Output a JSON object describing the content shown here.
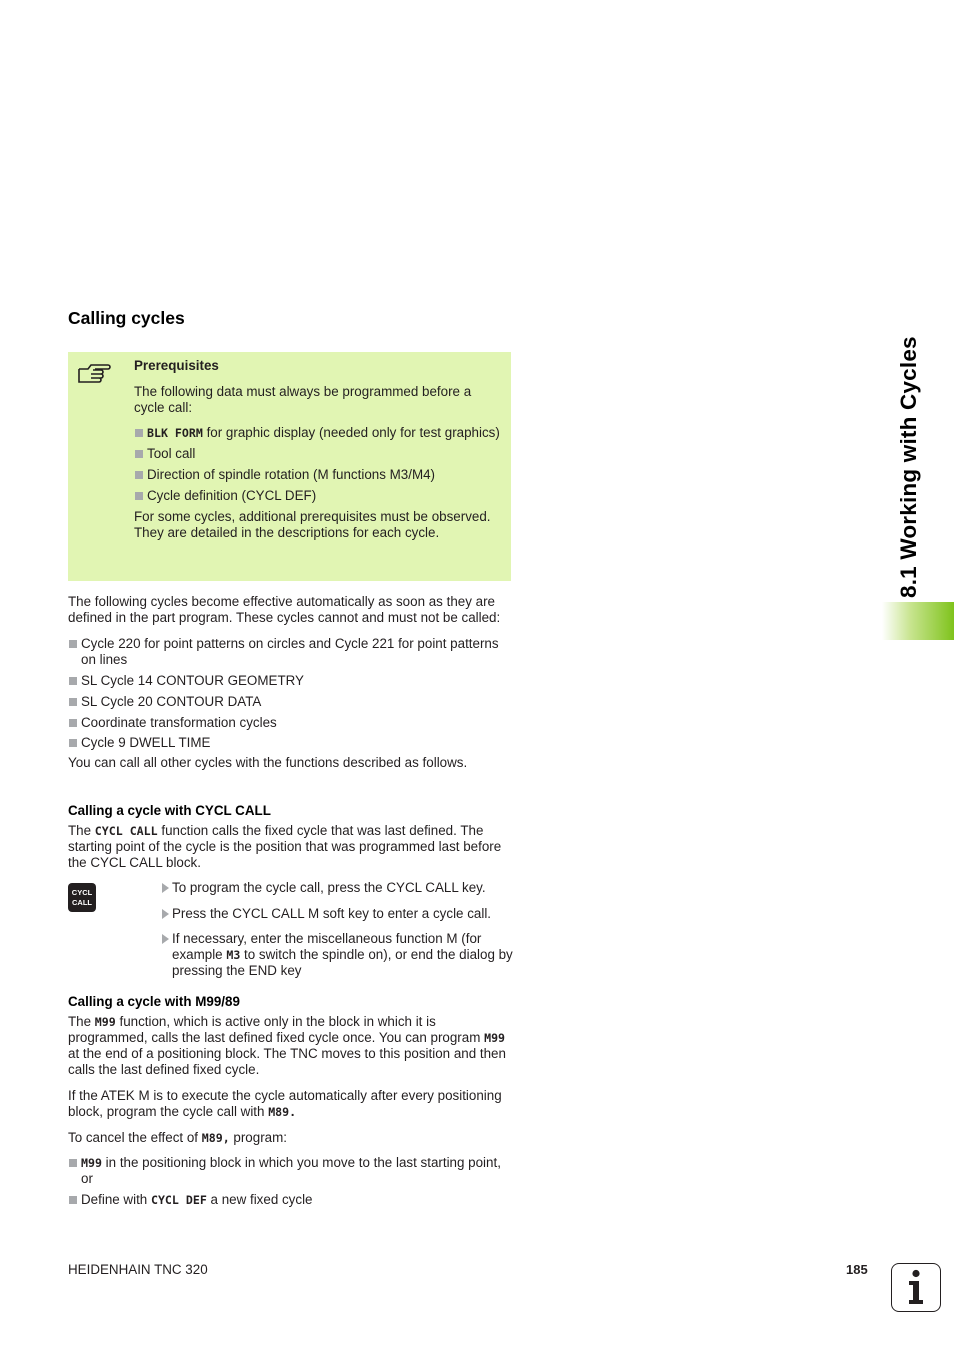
{
  "section_title": "Calling cycles",
  "note": {
    "icon": "pointing-hand-icon",
    "title": "Prerequisites",
    "intro": "The following data must always be programmed before a cycle call:",
    "items": [
      {
        "code": "BLK FORM",
        "text": " for graphic display (needed only for test graphics)"
      },
      {
        "code": "",
        "text": "Tool call"
      },
      {
        "code": "",
        "text": "Direction of spindle rotation (M functions M3/M4)"
      },
      {
        "code": "",
        "text": "Cycle definition (CYCL DEF)"
      }
    ],
    "outro": "For some cycles, additional prerequisites must be observed. They are detailed in the descriptions for each cycle."
  },
  "auto_intro": "The following cycles become effective automatically as soon as they are defined in the part program. These cycles cannot and must not be called:",
  "auto_items": [
    "Cycle 220 for point patterns on circles and Cycle 221 for point patterns on lines",
    "SL Cycle 14 CONTOUR GEOMETRY",
    "SL Cycle 20 CONTOUR DATA",
    "Coordinate transformation cycles",
    "Cycle 9 DWELL TIME"
  ],
  "auto_outro": "You can call all other cycles with the functions described as follows.",
  "cycl_call": {
    "heading": "Calling a cycle with CYCL CALL",
    "p_pre": "The ",
    "p_code": "CYCL CALL",
    "p_post": " function calls the fixed cycle that was last defined. The starting point of the cycle is the position that was programmed last before the CYCL CALL block.",
    "key_line1": "CYCL",
    "key_line2": "CALL",
    "steps": [
      {
        "pre": "To program the cycle call, press the CYCL CALL key.",
        "code": "",
        "post": ""
      },
      {
        "pre": "Press the CYCL CALL M soft key to enter a cycle call.",
        "code": "",
        "post": ""
      },
      {
        "pre": "If necessary, enter the miscellaneous function M (for example ",
        "code": "M3",
        "post": " to switch the spindle on), or end the dialog by pressing the END key"
      }
    ]
  },
  "m99": {
    "heading": "Calling a cycle with M99/89",
    "p1_a": "The ",
    "p1_code1": "M99",
    "p1_b": " function, which is active only in the block in which it is programmed, calls the last defined fixed cycle once. You can program ",
    "p1_code2": "M99",
    "p1_c": " at the end of a positioning block. The TNC moves to this position and then calls the last defined fixed cycle.",
    "p2_a": "If the ATEK M is to execute the cycle automatically after every positioning block, program the cycle call with ",
    "p2_code": "M89.",
    "p3_a": "To cancel the effect of ",
    "p3_code": "M89,",
    "p3_b": " program:",
    "items": [
      {
        "pre": "",
        "code": "M99",
        "post": " in the positioning block in which you move to the last starting point, or"
      },
      {
        "pre": "Define with ",
        "code": "CYCL DEF",
        "post": " a new fixed cycle"
      }
    ]
  },
  "sidebar": {
    "chapter_title": "8.1 Working with Cycles",
    "accent": "#7fc31c"
  },
  "footer": {
    "product": "HEIDENHAIN TNC 320",
    "page_number": "185",
    "icon": "info-icon"
  }
}
